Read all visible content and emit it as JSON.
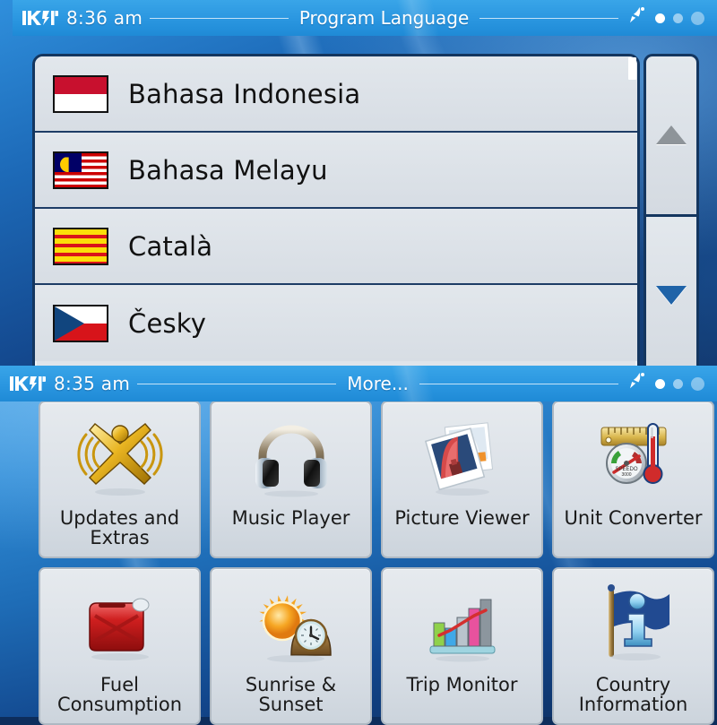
{
  "screen_language": {
    "status": {
      "clock": "8:36 am",
      "title": "Program Language",
      "logo_icon": "igo-logo-icon",
      "gps_icon": "satellite-dish-icon",
      "battery_dots": [
        "dot-full",
        "dot-dim",
        "dot-dimmer"
      ]
    },
    "list": [
      {
        "label": "Bahasa Indonesia",
        "flag_icon": "flag-indonesia",
        "flag_class": "f-id"
      },
      {
        "label": "Bahasa Melayu",
        "flag_icon": "flag-malaysia",
        "flag_class": "f-my"
      },
      {
        "label": "Català",
        "flag_icon": "flag-catalonia",
        "flag_class": "f-cat"
      },
      {
        "label": "Česky",
        "flag_icon": "flag-czech",
        "flag_class": "f-cz"
      }
    ],
    "scroll": {
      "up_icon": "triangle-up-icon",
      "down_icon": "triangle-down-icon",
      "up_enabled": false,
      "down_enabled": true,
      "up_color": "#8e9499",
      "down_color": "#1f63a8"
    }
  },
  "screen_more": {
    "status": {
      "clock": "8:35 am",
      "title": "More...",
      "logo_icon": "igo-logo-icon",
      "gps_icon": "satellite-dish-icon",
      "battery_dots": [
        "dot-full",
        "dot-dim",
        "dot-dimmer"
      ]
    },
    "tiles": [
      {
        "label": "Updates and Extras",
        "icon": "updates-extras-icon"
      },
      {
        "label": "Music Player",
        "icon": "headphones-icon"
      },
      {
        "label": "Picture Viewer",
        "icon": "photos-icon"
      },
      {
        "label": "Unit Converter",
        "icon": "ruler-thermometer-icon"
      },
      {
        "label": "",
        "icon": "partial-tile-icon"
      },
      {
        "label": "Fuel Consumption",
        "icon": "jerry-can-icon"
      },
      {
        "label": "Sunrise & Sunset",
        "icon": "sun-clock-icon"
      },
      {
        "label": "Trip Monitor",
        "icon": "bar-chart-icon"
      },
      {
        "label": "Country Information",
        "icon": "info-flag-icon"
      },
      {
        "label": "",
        "icon": "partial-tile-icon"
      }
    ]
  },
  "colors": {
    "status_blue": "#2a96e0",
    "panel_gray": "#dfe4ea",
    "border_navy": "#14365f",
    "bg_deep": "#0c2c5b"
  }
}
